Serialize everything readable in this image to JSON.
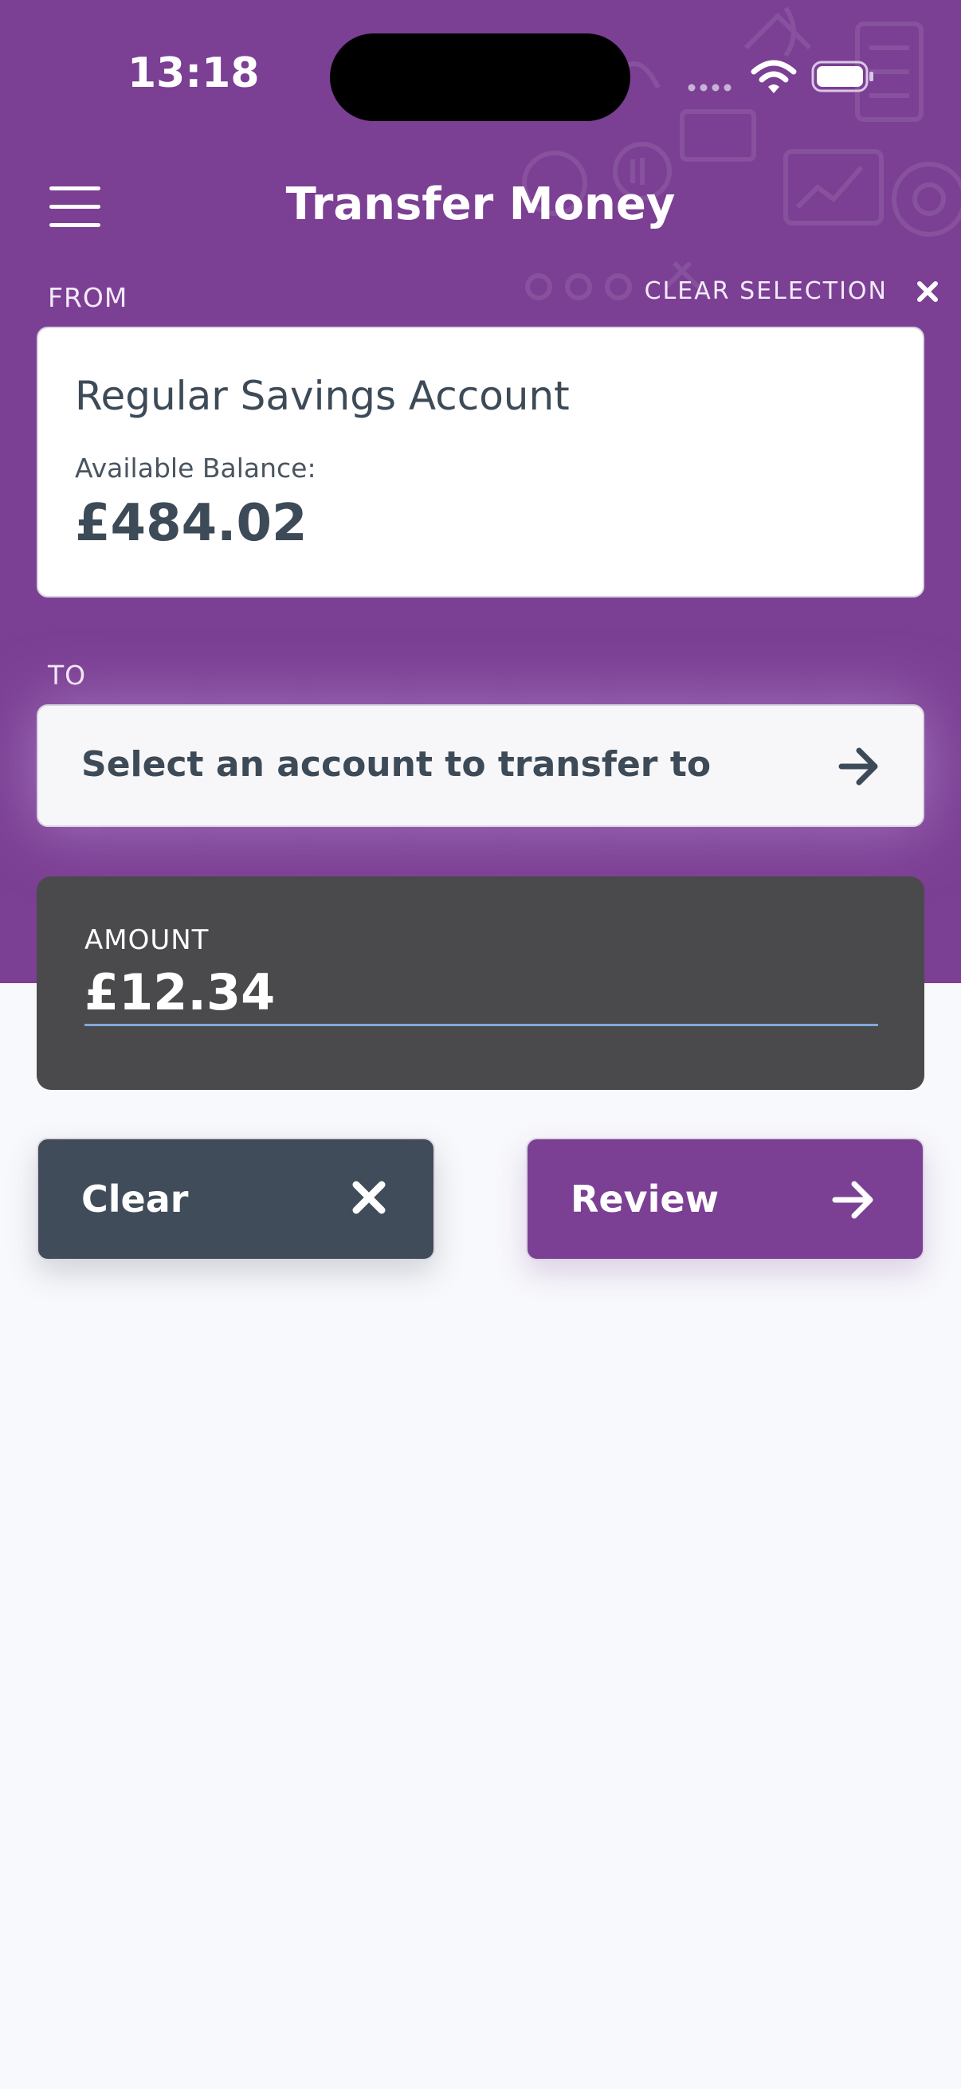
{
  "status_bar": {
    "time": "13:18",
    "icons": [
      "signal-dots-icon",
      "wifi-icon",
      "battery-icon"
    ]
  },
  "header": {
    "title": "Transfer Money",
    "menu_icon": "hamburger-menu-icon"
  },
  "from": {
    "label": "FROM",
    "clear_selection_label": "CLEAR SELECTION",
    "clear_selection_icon": "close-icon",
    "account_name": "Regular Savings Account",
    "balance_label": "Available Balance:",
    "balance_value": "£484.02"
  },
  "to": {
    "label": "TO",
    "placeholder": "Select an account to transfer to",
    "icon": "arrow-right-icon"
  },
  "amount": {
    "label": "AMOUNT",
    "value": "£12.34"
  },
  "actions": {
    "clear_label": "Clear",
    "clear_icon": "close-icon",
    "review_label": "Review",
    "review_icon": "arrow-right-icon"
  },
  "colors": {
    "brand_purple": "#7b3f94",
    "amount_card": "#4a4a4d",
    "clear_button": "#404c59",
    "text_dark": "#3d4a57",
    "page_background": "#f8f9fc"
  }
}
